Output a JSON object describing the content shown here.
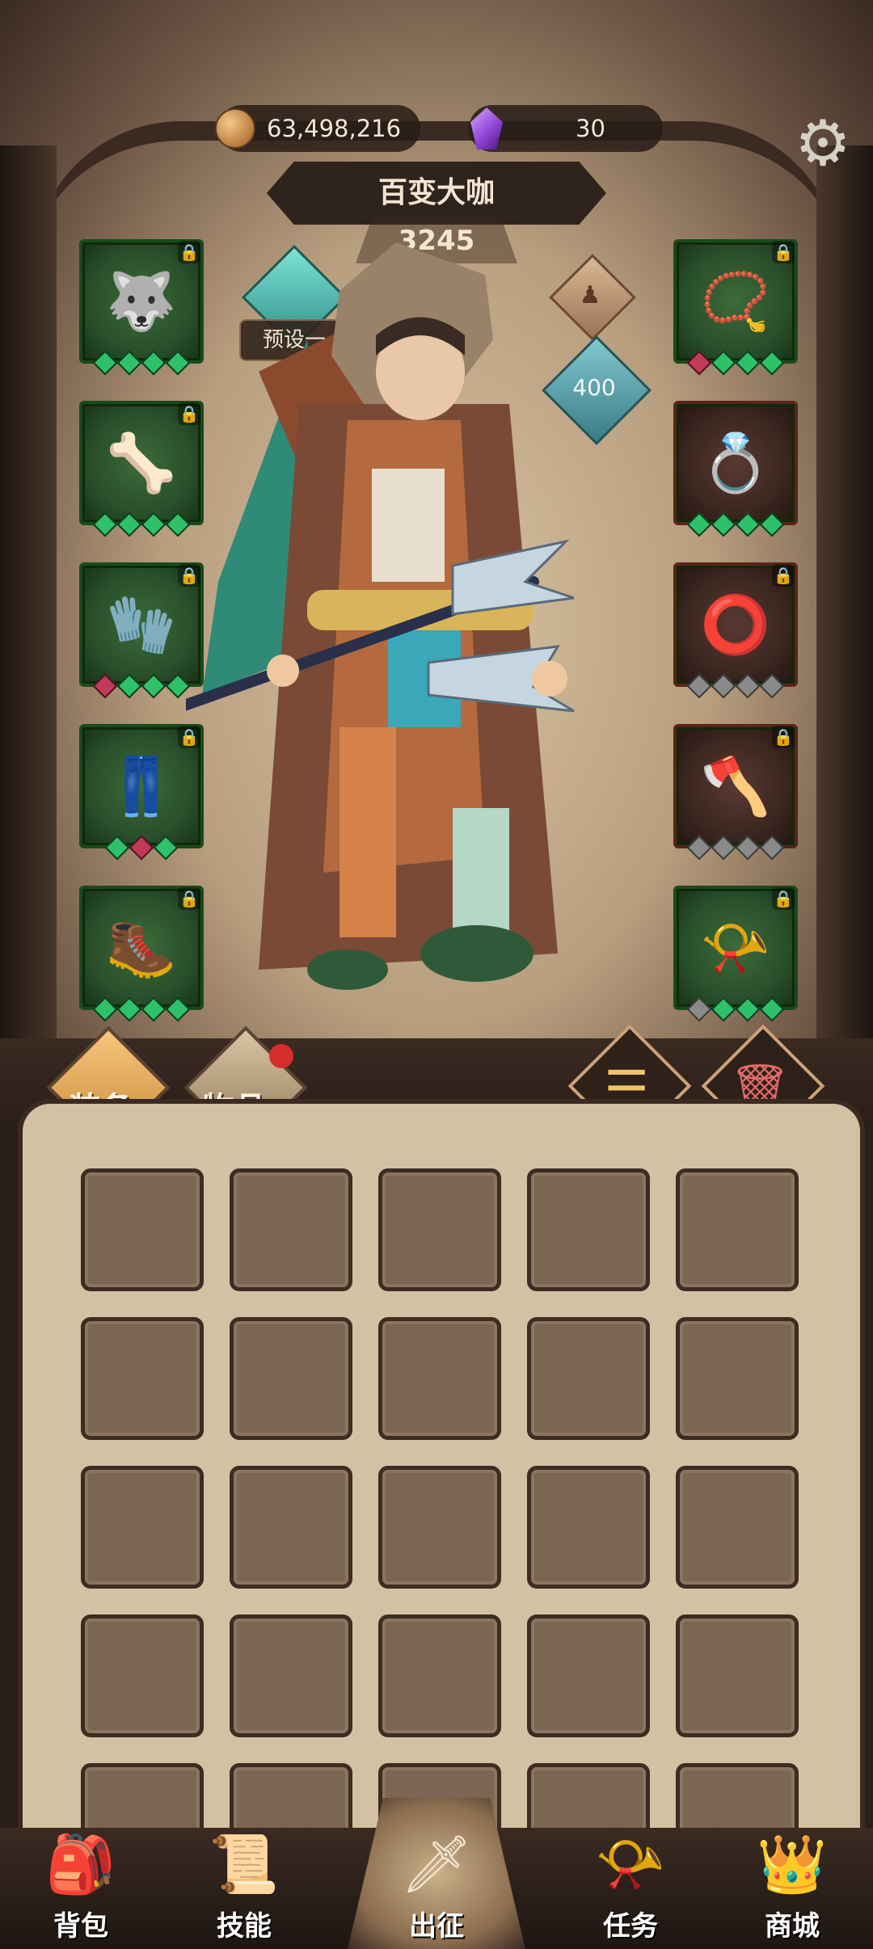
{
  "header": {
    "gold_amount": "63,498,216",
    "gem_amount": "30",
    "hero_name": "百变大咖",
    "power_value": "3245",
    "preset_label": "预设一",
    "level_value": "400"
  },
  "slots_left": [
    {
      "name": "slot-helmet",
      "icon": "wolf-helmet-icon",
      "glyph": "🐺",
      "frame": "green",
      "pips": [
        "green",
        "green",
        "green",
        "green"
      ]
    },
    {
      "name": "slot-shoulder",
      "icon": "shoulder-armor-icon",
      "glyph": "🦴",
      "frame": "green",
      "pips": [
        "green",
        "green",
        "green",
        "green"
      ]
    },
    {
      "name": "slot-gloves",
      "icon": "gauntlet-icon",
      "glyph": "🧤",
      "frame": "green",
      "pips": [
        "red",
        "green",
        "green",
        "green"
      ]
    },
    {
      "name": "slot-pants",
      "icon": "pants-icon",
      "glyph": "👖",
      "frame": "green",
      "pips": [
        "green",
        "red",
        "green"
      ]
    },
    {
      "name": "slot-boots",
      "icon": "boots-icon",
      "glyph": "🥾",
      "frame": "green",
      "pips": [
        "green",
        "green",
        "green",
        "green"
      ]
    }
  ],
  "slots_right": [
    {
      "name": "slot-necklace",
      "icon": "necklace-icon",
      "glyph": "📿",
      "frame": "green",
      "pips": [
        "red",
        "green",
        "green",
        "green"
      ]
    },
    {
      "name": "slot-ring1",
      "icon": "gem-ring-icon",
      "glyph": "💍",
      "frame": "red",
      "pips": [
        "green",
        "green",
        "green",
        "green"
      ]
    },
    {
      "name": "slot-ring2",
      "icon": "dark-ring-icon",
      "glyph": "⭕",
      "frame": "red",
      "pips": [
        "grey",
        "grey",
        "grey",
        "grey"
      ]
    },
    {
      "name": "slot-weapon",
      "icon": "axe-icon",
      "glyph": "🪓",
      "frame": "red",
      "pips": [
        "grey",
        "grey",
        "grey",
        "grey"
      ]
    },
    {
      "name": "slot-horn",
      "icon": "horn-icon",
      "glyph": "📯",
      "frame": "green",
      "pips": [
        "grey",
        "green",
        "green",
        "green"
      ]
    }
  ],
  "tabs": {
    "equip_label": "装备",
    "items_label": "物品"
  },
  "nav": {
    "bag": "背包",
    "skills": "技能",
    "expedition": "出征",
    "quests": "任务",
    "shop": "商城"
  },
  "colors": {
    "slot_green": "#2a4f2b",
    "slot_red": "#3b2620",
    "accent_gold": "#f7c67a",
    "badge_red": "#d72d2d"
  }
}
